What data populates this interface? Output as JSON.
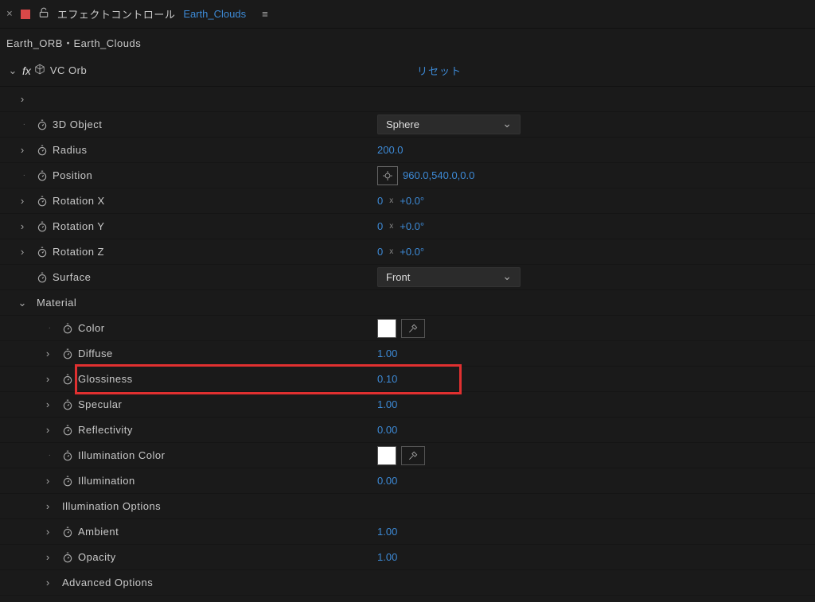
{
  "header": {
    "panel_title": "エフェクトコントロール",
    "active_layer": "Earth_Clouds"
  },
  "breadcrumb": "Earth_ORB・Earth_Clouds",
  "effect": {
    "name": "VC Orb",
    "reset": "リセット"
  },
  "props": {
    "object3d": {
      "label": "3D Object",
      "value": "Sphere"
    },
    "radius": {
      "label": "Radius",
      "value": "200.0"
    },
    "position": {
      "label": "Position",
      "value": "960.0,540.0,0.0"
    },
    "rotx": {
      "label": "Rotation X",
      "revs": "0",
      "deg": "+0.0°"
    },
    "roty": {
      "label": "Rotation Y",
      "revs": "0",
      "deg": "+0.0°"
    },
    "rotz": {
      "label": "Rotation Z",
      "revs": "0",
      "deg": "+0.0°"
    },
    "surface": {
      "label": "Surface",
      "value": "Front"
    }
  },
  "material": {
    "group": "Material",
    "color": {
      "label": "Color"
    },
    "diffuse": {
      "label": "Diffuse",
      "value": "1.00"
    },
    "glossiness": {
      "label": "Glossiness",
      "value": "0.10"
    },
    "specular": {
      "label": "Specular",
      "value": "1.00"
    },
    "reflectivity": {
      "label": "Reflectivity",
      "value": "0.00"
    },
    "illum_color": {
      "label": "Illumination Color"
    },
    "illumination": {
      "label": "Illumination",
      "value": "0.00"
    },
    "illum_options": {
      "label": "Illumination Options"
    },
    "ambient": {
      "label": "Ambient",
      "value": "1.00"
    },
    "opacity": {
      "label": "Opacity",
      "value": "1.00"
    },
    "advanced": {
      "label": "Advanced Options"
    }
  }
}
